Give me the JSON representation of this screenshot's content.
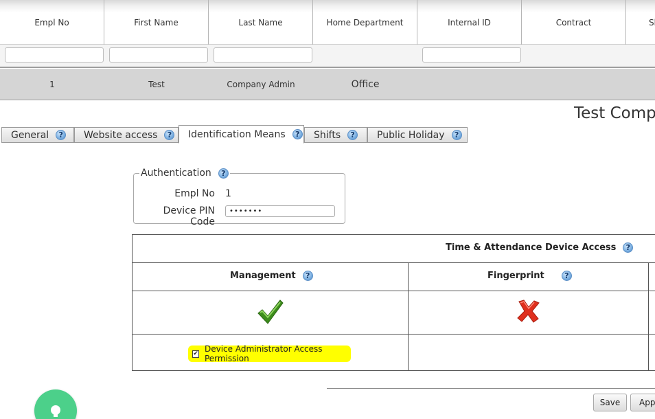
{
  "grid": {
    "columns": [
      "Empl No",
      "First Name",
      "Last Name",
      "Home Department",
      "Internal ID",
      "Contract",
      "Sh"
    ],
    "row": {
      "empl_no": "1",
      "first_name": "Test",
      "last_name": "Company Admin",
      "home_department": "Office"
    }
  },
  "details": {
    "company_title": "Test Compa",
    "tabs": [
      "General",
      "Website access",
      "Identification Means",
      "Shifts",
      "Public Holiday"
    ],
    "active_tab": "Identification Means",
    "help_glyph": "?",
    "authentication": {
      "legend": "Authentication",
      "empl_no_label": "Empl No",
      "empl_no_value": "1",
      "pin_label": "Device PIN Code",
      "pin_value": "•••••••"
    },
    "access_table": {
      "title": "Time & Attendance Device Access",
      "management_header": "Management",
      "fingerprint_header": "Fingerprint",
      "management_enabled": true,
      "fingerprint_enabled": false,
      "permission_label": "Device Administrator Access Permission",
      "permission_checked": true
    }
  },
  "buttons": {
    "save": "Save",
    "apply": "Appl"
  },
  "colors": {
    "highlight": "#ffff00",
    "check": "#3c8c1c",
    "cross": "#e0301e",
    "fab": "#4cd08a"
  },
  "icons": {
    "help": "help-icon",
    "check": "check-icon",
    "cross": "cross-icon",
    "fab": "lightbulb-icon"
  }
}
